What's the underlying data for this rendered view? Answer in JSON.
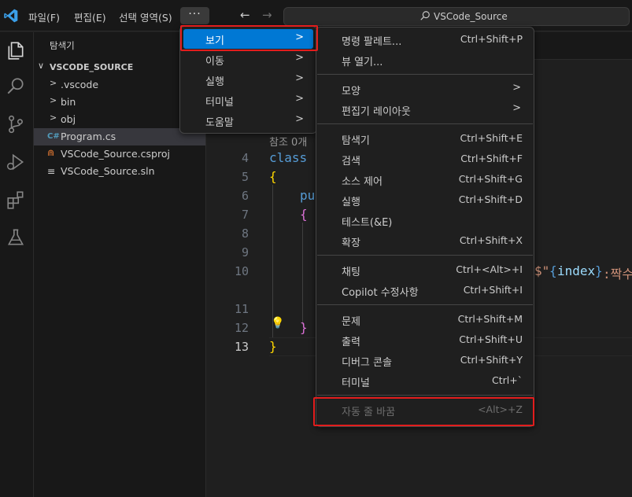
{
  "titlebar": {
    "menus": [
      "파일(F)",
      "편집(E)",
      "선택 영역(S)"
    ],
    "more_label": "···",
    "back_arrow": "←",
    "forward_arrow": "→",
    "search_label": "VSCode_Source"
  },
  "activity_bar": {
    "icons": [
      "explorer-icon",
      "search-icon",
      "source-control-icon",
      "run-debug-icon",
      "extensions-icon",
      "testing-icon"
    ]
  },
  "sidebar": {
    "title": "탐색기",
    "root": {
      "chevron": "∨",
      "label": "VSCODE_SOURCE"
    },
    "items": [
      {
        "chevron": ">",
        "label": ".vscode",
        "icon": "folder"
      },
      {
        "chevron": ">",
        "label": "bin",
        "icon": "folder"
      },
      {
        "chevron": ">",
        "label": "obj",
        "icon": "folder"
      },
      {
        "icon_text": "C#",
        "label": "Program.cs",
        "icon": "csharp-file-icon",
        "selected": true
      },
      {
        "icon_text": "⋒",
        "label": "VSCode_Source.csproj",
        "icon": "rss-file-icon"
      },
      {
        "icon_text": "≡",
        "label": "VSCode_Source.sln",
        "icon": "sln-file-icon"
      }
    ]
  },
  "editor": {
    "codelens": "참조 0개",
    "line_numbers": [
      "4",
      "5",
      "6",
      "7",
      "8",
      "9",
      "10",
      "11",
      "12",
      "13"
    ],
    "active_line": "13",
    "code": {
      "l4": "class",
      "l5": "{",
      "l6": "pu",
      "l7": "{",
      "l10_dollar": "$\"",
      "l10_brace_open": "{",
      "l10_ident": "index",
      "l10_brace_close": "}",
      "l10_rest": ":짝수",
      "l12": "}",
      "l13": "}"
    },
    "lightbulb": "💡"
  },
  "menu_left": {
    "items": [
      {
        "label": "보기",
        "chevron": ">",
        "active": true
      },
      {
        "label": "이동",
        "chevron": ">"
      },
      {
        "label": "실행",
        "chevron": ">"
      },
      {
        "label": "터미널",
        "chevron": ">"
      },
      {
        "label": "도움말",
        "chevron": ">"
      }
    ]
  },
  "menu_view": {
    "groups": [
      [
        {
          "label": "명령 팔레트...",
          "shortcut": "Ctrl+Shift+P"
        },
        {
          "label": "뷰 열기..."
        }
      ],
      [
        {
          "label": "모양",
          "chevron": ">"
        },
        {
          "label": "편집기 레이아웃",
          "chevron": ">"
        }
      ],
      [
        {
          "label": "탐색기",
          "shortcut": "Ctrl+Shift+E"
        },
        {
          "label": "검색",
          "shortcut": "Ctrl+Shift+F"
        },
        {
          "label": "소스 제어",
          "shortcut": "Ctrl+Shift+G"
        },
        {
          "label": "실행",
          "shortcut": "Ctrl+Shift+D"
        },
        {
          "label": "테스트(&E)"
        },
        {
          "label": "확장",
          "shortcut": "Ctrl+Shift+X"
        }
      ],
      [
        {
          "label": "채팅",
          "shortcut": "Ctrl+<Alt>+I"
        },
        {
          "label": "Copilot 수정사항",
          "shortcut": "Ctrl+Shift+I"
        }
      ],
      [
        {
          "label": "문제",
          "shortcut": "Ctrl+Shift+M"
        },
        {
          "label": "출력",
          "shortcut": "Ctrl+Shift+U"
        },
        {
          "label": "디버그 콘솔",
          "shortcut": "Ctrl+Shift+Y"
        },
        {
          "label": "터미널",
          "shortcut": "Ctrl+`"
        }
      ],
      [
        {
          "label": "자동 줄 바꿈",
          "shortcut": "<Alt>+Z",
          "disabled": true
        }
      ]
    ]
  },
  "colors": {
    "accent": "#0078d4",
    "highlight_box": "#e21d1d",
    "keyword": "#569cd6",
    "bracket_gold": "#ffd700",
    "bracket_pink": "#da70d6"
  }
}
